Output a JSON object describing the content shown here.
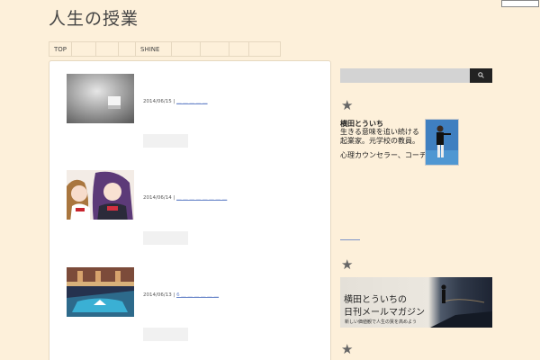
{
  "site": {
    "title": "人生の授業"
  },
  "nav": {
    "items": [
      "TOP",
      "",
      "",
      "",
      "SHINE",
      "",
      "",
      "",
      ""
    ]
  },
  "posts": [
    {
      "date": "2014/06/15",
      "separator": "|",
      "link_text": "＿ ＿ ＿ ＿ ＿"
    },
    {
      "date": "2014/06/14",
      "separator": "|",
      "link_text": "＿ ＿ ＿ ＿ ＿ ＿ ＿ ＿"
    },
    {
      "date": "2014/06/13",
      "separator": "|",
      "link_text": "6 ＿ ＿ ＿ ＿ ＿ ＿"
    }
  ],
  "sidebar": {
    "search": {
      "value": "",
      "button_icon": "search-icon"
    },
    "widget_icon": "star-icon",
    "profile": {
      "name": "横田とういち",
      "description": "生きる意味を追い続ける起業家。元学校の教員。",
      "role": "心理カウンセラー、コーチ。"
    },
    "banner": {
      "line1": "横田とういちの",
      "line2": "日刊メールマガジン",
      "subtitle": "新しい価値観で人生の質を高めよう"
    }
  }
}
